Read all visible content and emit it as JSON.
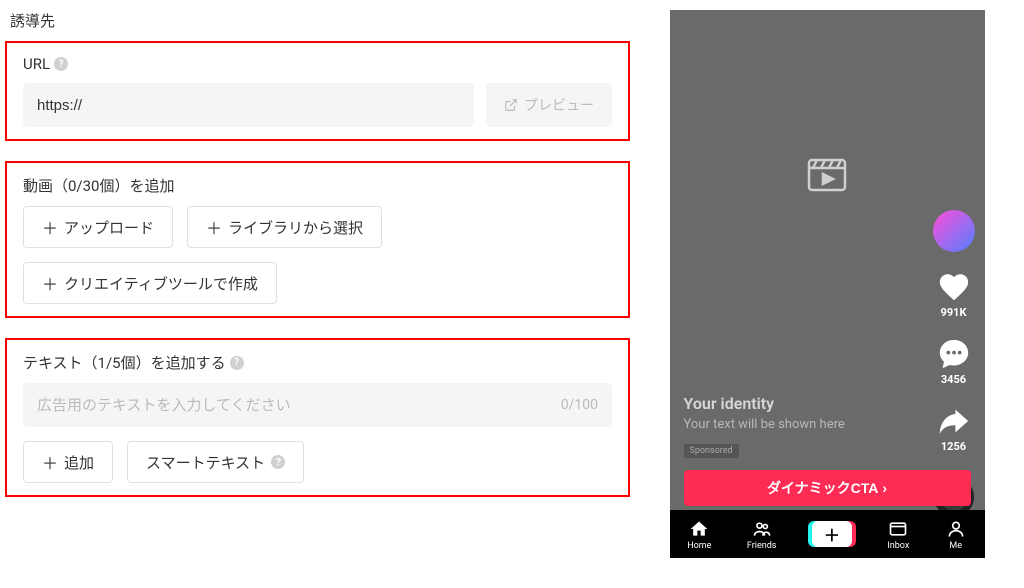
{
  "destination": {
    "title": "誘導先",
    "url_label": "URL",
    "url_value": "https://",
    "preview_label": "プレビュー"
  },
  "video_section": {
    "title": "動画（0/30個）を追加",
    "upload_label": "アップロード",
    "library_label": "ライブラリから選択",
    "creative_tool_label": "クリエイティブツールで作成"
  },
  "text_section": {
    "title": "テキスト（1/5個）を追加する",
    "placeholder": "広告用のテキストを入力してください",
    "char_count": "0/100",
    "add_label": "追加",
    "smart_text_label": "スマートテキスト"
  },
  "preview": {
    "identity": "Your identity",
    "text_placeholder": "Your text will be shown here",
    "sponsored": "Sponsored",
    "cta_label": "ダイナミックCTA",
    "likes": "991K",
    "comments": "3456",
    "shares": "1256",
    "nav": {
      "home": "Home",
      "friends": "Friends",
      "inbox": "Inbox",
      "me": "Me"
    }
  }
}
